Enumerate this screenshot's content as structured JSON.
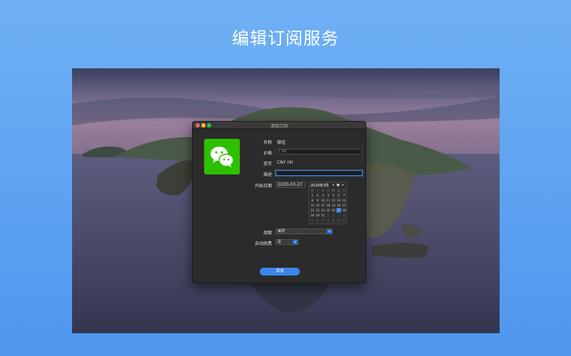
{
  "headline": "编辑订阅服务",
  "window": {
    "title": "添加订阅",
    "form": {
      "name_label": "名称",
      "name_value": "微信",
      "price_label": "价格",
      "price_placeholder": "2.99",
      "currency_label": "货币",
      "currency_value": "CNY (¥)",
      "desc_label": "描述",
      "desc_value": "",
      "start_label": "开始日期",
      "start_value": "2020-03-27",
      "period_label": "周期",
      "period_value": "每周",
      "autorenew_label": "自动续费",
      "autorenew_value": "是",
      "add_button": "添加"
    },
    "calendar": {
      "title": "2020年3月",
      "nav": "◂ ● ▸",
      "weekdays": [
        "日",
        "一",
        "二",
        "三",
        "四",
        "五",
        "六"
      ],
      "weeks": [
        [
          "1",
          "2",
          "3",
          "4",
          "5",
          "6",
          "7"
        ],
        [
          "8",
          "9",
          "10",
          "11",
          "12",
          "13",
          "14"
        ],
        [
          "15",
          "16",
          "17",
          "18",
          "19",
          "20",
          "21"
        ],
        [
          "22",
          "23",
          "24",
          "25",
          "26",
          "27",
          "28"
        ],
        [
          "29",
          "30",
          "31",
          "1",
          "2",
          "3",
          "4"
        ],
        [
          "5",
          "6",
          "7",
          "8",
          "9",
          "10",
          "11"
        ]
      ],
      "selected": "27"
    }
  },
  "colors": {
    "accent": "#3b86e8",
    "wechat_green": "#2dc100"
  },
  "icons": {
    "app_icon": "wechat-icon"
  }
}
